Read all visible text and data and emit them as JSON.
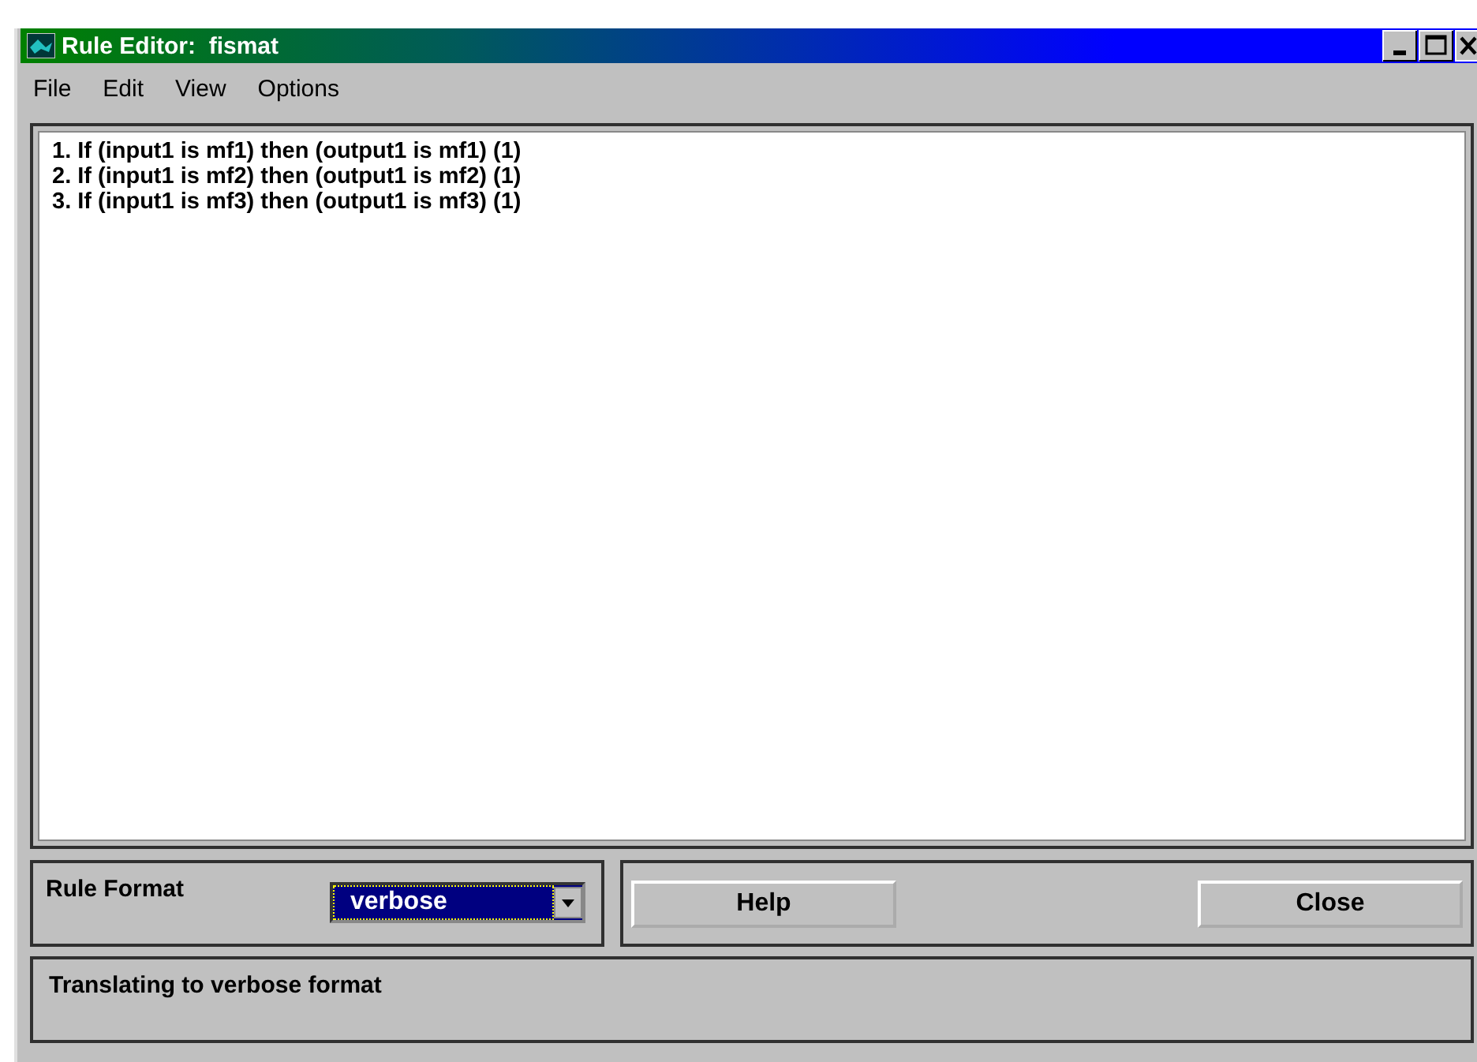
{
  "window": {
    "title": "Rule Editor:  fismat"
  },
  "menu": [
    "File",
    "Edit",
    "View",
    "Options"
  ],
  "rules": [
    "1. If (input1 is mf1) then (output1 is mf1) (1)",
    "2. If (input1 is mf2) then (output1 is mf2) (1)",
    "3. If (input1 is mf3) then (output1 is mf3) (1)"
  ],
  "rule_format": {
    "label": "Rule Format",
    "value": "verbose"
  },
  "buttons": [
    "Help",
    "Close"
  ],
  "status_bar": "Translating to verbose format"
}
